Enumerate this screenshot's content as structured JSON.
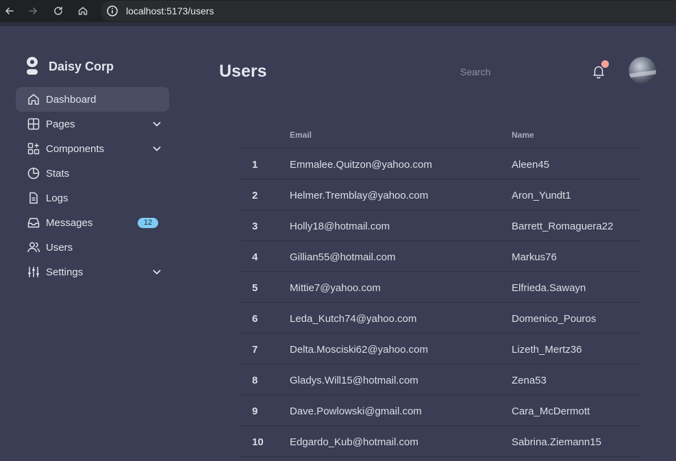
{
  "browser": {
    "url": "localhost:5173/users"
  },
  "brand": {
    "name": "Daisy Corp"
  },
  "sidebar": {
    "items": [
      {
        "label": "Dashboard",
        "icon": "home-icon",
        "active": true
      },
      {
        "label": "Pages",
        "icon": "grid-icon",
        "chevron": true
      },
      {
        "label": "Components",
        "icon": "components-icon",
        "chevron": true
      },
      {
        "label": "Stats",
        "icon": "pie-chart-icon"
      },
      {
        "label": "Logs",
        "icon": "document-icon"
      },
      {
        "label": "Messages",
        "icon": "inbox-icon",
        "badge": "12"
      },
      {
        "label": "Users",
        "icon": "users-icon"
      },
      {
        "label": "Settings",
        "icon": "sliders-icon",
        "chevron": true
      }
    ]
  },
  "header": {
    "title": "Users",
    "search_placeholder": "Search"
  },
  "table": {
    "columns": [
      "",
      "Email",
      "Name"
    ],
    "rows": [
      {
        "num": "1",
        "email": "Emmalee.Quitzon@yahoo.com",
        "name": "Aleen45"
      },
      {
        "num": "2",
        "email": "Helmer.Tremblay@yahoo.com",
        "name": "Aron_Yundt1"
      },
      {
        "num": "3",
        "email": "Holly18@hotmail.com",
        "name": "Barrett_Romaguera22"
      },
      {
        "num": "4",
        "email": "Gillian55@hotmail.com",
        "name": "Markus76"
      },
      {
        "num": "5",
        "email": "Mittie7@yahoo.com",
        "name": "Elfrieda.Sawayn"
      },
      {
        "num": "6",
        "email": "Leda_Kutch74@yahoo.com",
        "name": "Domenico_Pouros"
      },
      {
        "num": "7",
        "email": "Delta.Mosciski62@yahoo.com",
        "name": "Lizeth_Mertz36"
      },
      {
        "num": "8",
        "email": "Gladys.Will15@hotmail.com",
        "name": "Zena53"
      },
      {
        "num": "9",
        "email": "Dave.Powlowski@gmail.com",
        "name": "Cara_McDermott"
      },
      {
        "num": "10",
        "email": "Edgardo_Kub@hotmail.com",
        "name": "Sabrina.Ziemann15"
      }
    ]
  },
  "colors": {
    "background": "#3a3d53",
    "active_item": "#4a4d63",
    "badge": "#7ecbf3",
    "notification_dot": "#f5a39a"
  }
}
